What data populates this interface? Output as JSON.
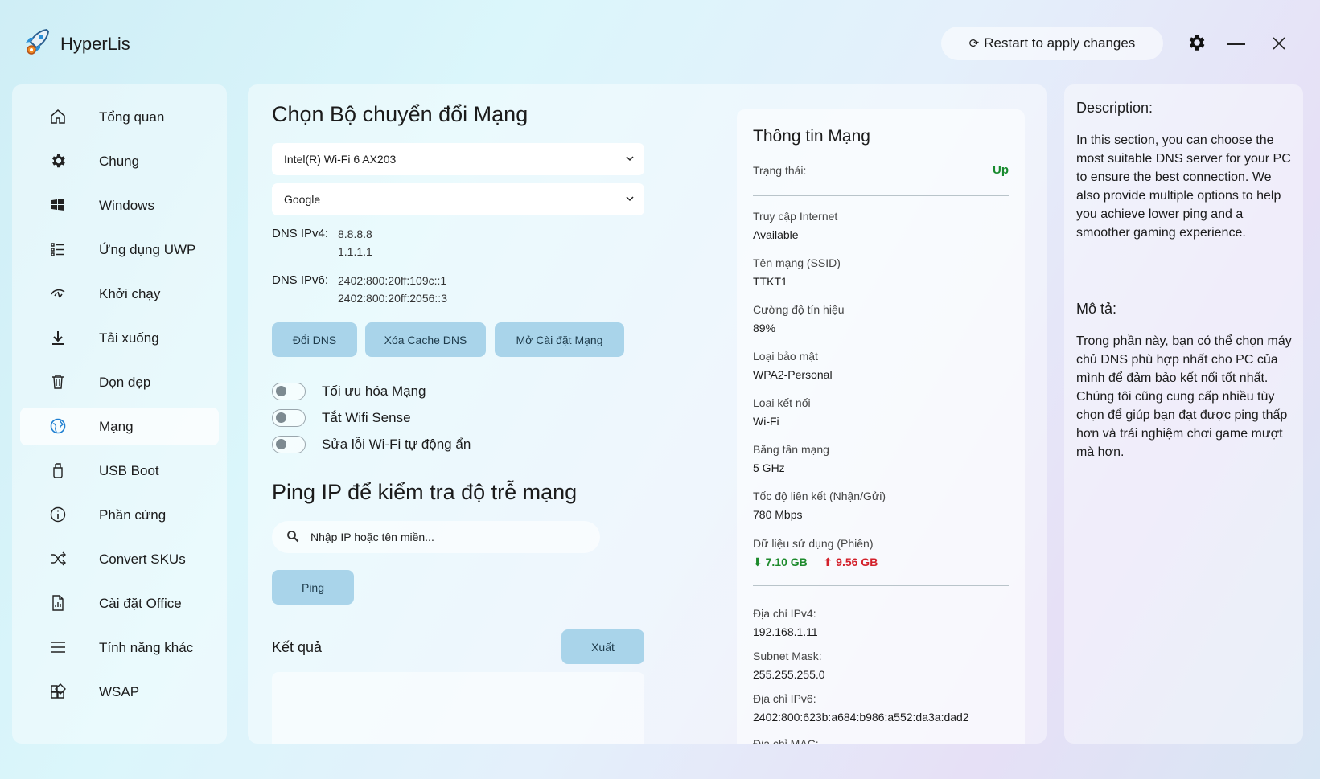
{
  "app": {
    "title": "HyperLis"
  },
  "titlebar": {
    "restart_label": "Restart to apply changes"
  },
  "sidebar": {
    "items": [
      {
        "label": "Tổng quan",
        "icon": "home-icon"
      },
      {
        "label": "Chung",
        "icon": "gear-icon"
      },
      {
        "label": "Windows",
        "icon": "windows-icon"
      },
      {
        "label": "Ứng dụng UWP",
        "icon": "list-icon"
      },
      {
        "label": "Khởi chạy",
        "icon": "startup-icon"
      },
      {
        "label": "Tải xuống",
        "icon": "download-icon"
      },
      {
        "label": "Dọn dẹp",
        "icon": "trash-icon"
      },
      {
        "label": "Mạng",
        "icon": "globe-icon",
        "active": true
      },
      {
        "label": "USB Boot",
        "icon": "usb-icon"
      },
      {
        "label": "Phần cứng",
        "icon": "info-icon"
      },
      {
        "label": "Convert SKUs",
        "icon": "shuffle-icon"
      },
      {
        "label": "Cài đặt Office",
        "icon": "office-document-icon"
      },
      {
        "label": "Tính năng khác",
        "icon": "menu-icon"
      },
      {
        "label": "WSAP",
        "icon": "apps-icon"
      }
    ]
  },
  "main": {
    "adapter_title": "Chọn Bộ chuyển đổi Mạng",
    "adapter_select": "Intel(R) Wi-Fi 6 AX203",
    "dns_select": "Google",
    "dns_ipv4_label": "DNS IPv4:",
    "dns_ipv4_values": [
      "8.8.8.8",
      "1.1.1.1"
    ],
    "dns_ipv6_label": "DNS IPv6:",
    "dns_ipv6_values": [
      "2402:800:20ff:109c::1",
      "2402:800:20ff:2056::3"
    ],
    "buttons": {
      "change_dns": "Đổi DNS",
      "flush_dns": "Xóa Cache DNS",
      "open_settings": "Mở Cài đặt Mạng"
    },
    "toggles": [
      {
        "label": "Tối ưu hóa Mạng",
        "on": false
      },
      {
        "label": "Tắt Wifi Sense",
        "on": false
      },
      {
        "label": "Sửa lỗi Wi-Fi tự động ẩn",
        "on": false
      }
    ],
    "ping_title": "Ping IP để kiểm tra độ trễ mạng",
    "ping_input_placeholder": "Nhập IP hoặc tên miền...",
    "ping_button": "Ping",
    "result_label": "Kết quả",
    "export_button": "Xuất"
  },
  "network_info": {
    "title": "Thông tin Mạng",
    "status_label": "Trạng thái:",
    "status_value": "Up",
    "internet_label": "Truy cập Internet",
    "internet_value": "Available",
    "ssid_label": "Tên mạng (SSID)",
    "ssid_value": "TTKT1",
    "signal_label": "Cường độ tín hiệu",
    "signal_value": "89%",
    "security_label": "Loại bảo mật",
    "security_value": "WPA2-Personal",
    "conn_type_label": "Loại kết nối",
    "conn_type_value": "Wi-Fi",
    "band_label": "Băng tần mạng",
    "band_value": "5 GHz",
    "link_speed_label": "Tốc độ liên kết (Nhận/Gửi)",
    "link_speed_value": "780 Mbps",
    "data_usage_label": "Dữ liệu sử dụng (Phiên)",
    "data_down": "7.10 GB",
    "data_up": "9.56 GB",
    "ipv4_label": "Địa chỉ IPv4:",
    "ipv4_value": "192.168.1.11",
    "subnet_label": "Subnet Mask:",
    "subnet_value": "255.255.255.0",
    "ipv6_label": "Địa chỉ IPv6:",
    "ipv6_value": "2402:800:623b:a684:b986:a552:da3a:dad2",
    "mac_label": "Địa chỉ MAC:"
  },
  "description": {
    "en_title": "Description:",
    "en_text": "In this section, you can choose the most suitable DNS server for your PC to ensure the best connection. We also provide multiple options to help you achieve lower ping and a smoother gaming experience.",
    "vi_title": "Mô tả:",
    "vi_text": "Trong phần này, bạn có thể chọn máy chủ DNS phù hợp nhất cho PC của mình để đảm bảo kết nối tốt nhất. Chúng tôi cũng cung cấp nhiều tùy chọn để giúp bạn đạt được ping thấp hơn và trải nghiệm chơi game mượt mà hơn."
  },
  "colors": {
    "accent_button": "#a9d4ea",
    "status_up": "#188a2e",
    "download": "#1d8a2c",
    "upload": "#d3202a"
  }
}
